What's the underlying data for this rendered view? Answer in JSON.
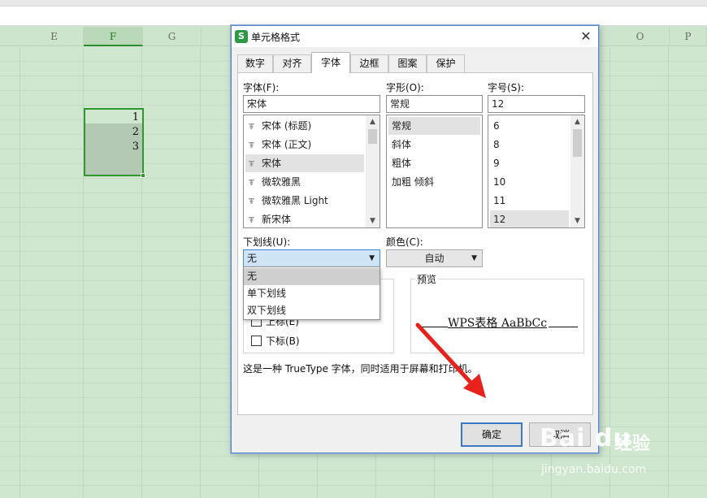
{
  "sheet": {
    "columns": [
      "E",
      "F",
      "G",
      "",
      "O",
      "P"
    ],
    "active_column": "F",
    "cells": [
      "1",
      "2",
      "3"
    ]
  },
  "dialog": {
    "title": "单元格格式",
    "close": "✕",
    "tabs": [
      {
        "label": "数字"
      },
      {
        "label": "对齐"
      },
      {
        "label": "字体",
        "active": true
      },
      {
        "label": "边框"
      },
      {
        "label": "图案"
      },
      {
        "label": "保护"
      }
    ],
    "font": {
      "label": "字体(F):",
      "value": "宋体",
      "items": [
        "宋体 (标题)",
        "宋体 (正文)",
        "宋体",
        "微软雅黑",
        "微软雅黑 Light",
        "新宋体"
      ],
      "selected": "宋体"
    },
    "style": {
      "label": "字形(O):",
      "value": "常规",
      "items": [
        "常规",
        "斜体",
        "粗体",
        "加粗 倾斜"
      ],
      "selected": "常规"
    },
    "size": {
      "label": "字号(S):",
      "value": "12",
      "items": [
        "6",
        "8",
        "9",
        "10",
        "11",
        "12"
      ],
      "selected": "12"
    },
    "underline": {
      "label": "下划线(U):",
      "value": "无",
      "options": [
        "无",
        "单下划线",
        "双下划线"
      ],
      "selected": "无"
    },
    "color": {
      "label": "颜色(C):",
      "value": "自动"
    },
    "effects": {
      "superscript": "上标(E)",
      "subscript": "下标(B)"
    },
    "preview": {
      "label": "预览",
      "text": "WPS表格  AaBbCc"
    },
    "info": "这是一种 TrueType 字体，同时适用于屏幕和打印机。",
    "ok": "确定",
    "cancel": "取消"
  },
  "watermark": {
    "logo": "Bai du",
    "text": "经验",
    "url": "jingyan.baidu.com"
  },
  "annotation_color": "#e8211c"
}
